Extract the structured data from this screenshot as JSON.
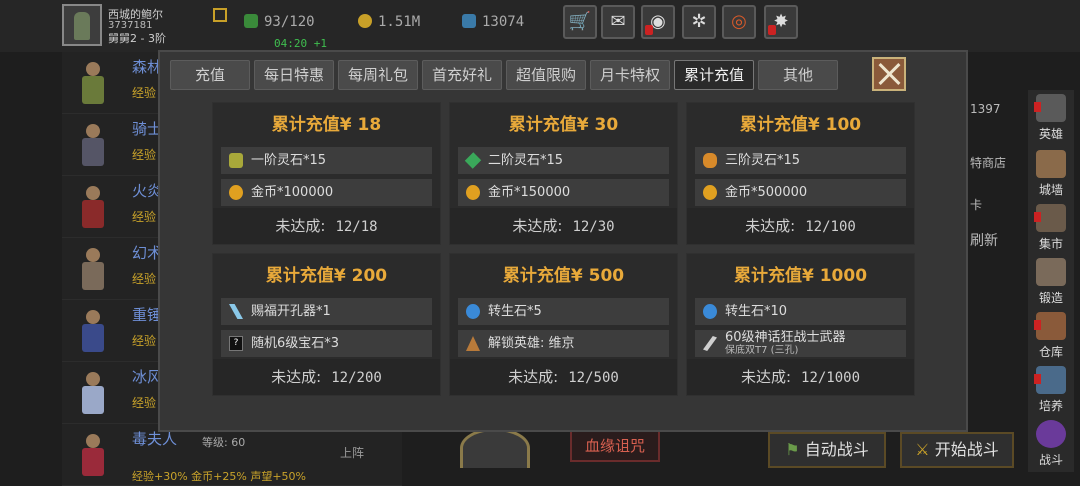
{
  "header": {
    "player_name": "西城的鲍尔",
    "player_id": "3737181",
    "player_rank": "舅舅2 - 3阶",
    "stamina": "93/120",
    "stamina_timer": "04:20 +1",
    "gold": "1.51M",
    "gems": "13074"
  },
  "heroes": [
    {
      "name": "森林",
      "exp": "经验"
    },
    {
      "name": "骑士",
      "exp": "经验"
    },
    {
      "name": "火炎",
      "exp": "经验"
    },
    {
      "name": "幻术",
      "exp": "经验"
    },
    {
      "name": "重锤",
      "exp": "经验"
    },
    {
      "name": "冰风",
      "exp": "经验"
    },
    {
      "name": "毒夫人",
      "level": "等级: 60",
      "bonus": "经验+30%  金币+25%  声望+50%",
      "deploy": "上阵"
    }
  ],
  "right_menu": [
    "英雄",
    "城墙",
    "集市",
    "锻造",
    "仓库",
    "培养",
    "战斗"
  ],
  "side_fragments": {
    "number": "1397",
    "shop": "特商店",
    "refresh": "刷新",
    "card": "卡"
  },
  "bottom": {
    "curse": "血缘诅咒",
    "auto_battle": "自动战斗",
    "start_battle": "开始战斗"
  },
  "modal": {
    "tabs": [
      "充值",
      "每日特惠",
      "每周礼包",
      "首充好礼",
      "超值限购",
      "月卡特权",
      "累计充值",
      "其他"
    ],
    "active_tab": "累计充值",
    "status_label": "未达成:",
    "cards": [
      {
        "title": "累计充值¥ 18",
        "progress": "12/18",
        "progress_value": 12,
        "progress_target": 18,
        "items": [
          {
            "icon": "tier1-spirit-stone-icon",
            "color": "#a8a83a",
            "text": "一阶灵石*15"
          },
          {
            "icon": "gold-coin-icon",
            "color": "#e0a020",
            "text": "金币*100000"
          }
        ]
      },
      {
        "title": "累计充值¥ 30",
        "progress": "12/30",
        "progress_value": 12,
        "progress_target": 30,
        "items": [
          {
            "icon": "tier2-spirit-stone-icon",
            "color": "#3aa85a",
            "text": "二阶灵石*15"
          },
          {
            "icon": "gold-coin-icon",
            "color": "#e0a020",
            "text": "金币*150000"
          }
        ]
      },
      {
        "title": "累计充值¥ 100",
        "progress": "12/100",
        "progress_value": 12,
        "progress_target": 100,
        "items": [
          {
            "icon": "tier3-spirit-stone-icon",
            "color": "#d88a2a",
            "text": "三阶灵石*15"
          },
          {
            "icon": "gold-coin-icon",
            "color": "#e0a020",
            "text": "金币*500000"
          }
        ]
      },
      {
        "title": "累计充值¥ 200",
        "progress": "12/200",
        "progress_value": 12,
        "progress_target": 200,
        "items": [
          {
            "icon": "socket-drill-icon",
            "color": "#8ac8e8",
            "text": "赐福开孔器*1"
          },
          {
            "icon": "random-gem-icon",
            "color": "#111111",
            "text": "随机6级宝石*3"
          }
        ]
      },
      {
        "title": "累计充值¥ 500",
        "progress": "12/500",
        "progress_value": 12,
        "progress_target": 500,
        "items": [
          {
            "icon": "rebirth-stone-icon",
            "color": "#3a8ad8",
            "text": "转生石*5"
          },
          {
            "icon": "unlock-hero-icon",
            "color": "#b87a3a",
            "text": "解锁英雄: 维京"
          }
        ]
      },
      {
        "title": "累计充值¥ 1000",
        "progress": "12/1000",
        "progress_value": 12,
        "progress_target": 1000,
        "items": [
          {
            "icon": "rebirth-stone-icon",
            "color": "#3a8ad8",
            "text": "转生石*10"
          },
          {
            "icon": "weapon-icon",
            "color": "#cfcfcf",
            "text": "60级神话狂战士武器",
            "sub": "保底双T7 (三孔)"
          }
        ]
      }
    ]
  }
}
